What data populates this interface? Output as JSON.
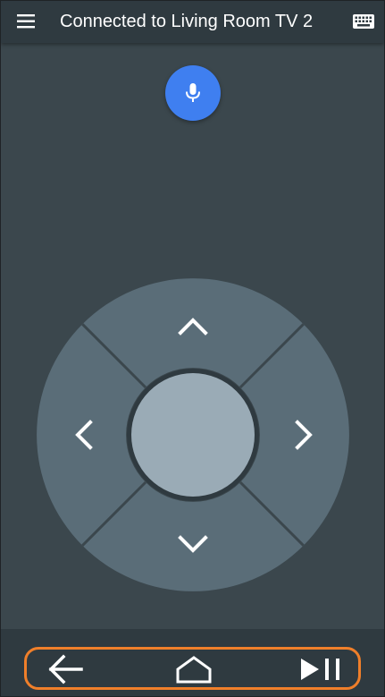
{
  "app_bar": {
    "title": "Connected to Living Room TV 2",
    "menu_icon": "hamburger-menu-icon",
    "keyboard_icon": "keyboard-icon"
  },
  "voice": {
    "icon": "microphone-icon"
  },
  "dpad": {
    "up_icon": "chevron-up-icon",
    "down_icon": "chevron-down-icon",
    "left_icon": "chevron-left-icon",
    "right_icon": "chevron-right-icon",
    "center": "ok-button"
  },
  "bottom_nav": {
    "back_icon": "back-arrow-icon",
    "home_icon": "home-icon",
    "play_pause_icon": "play-pause-icon",
    "highlight_color": "#f07f2a"
  },
  "colors": {
    "background": "#3b474d",
    "bars": "#2f3a40",
    "dpad": "#5a6d78",
    "dpad_center": "#9aabb6",
    "mic": "#3f7ff0"
  }
}
